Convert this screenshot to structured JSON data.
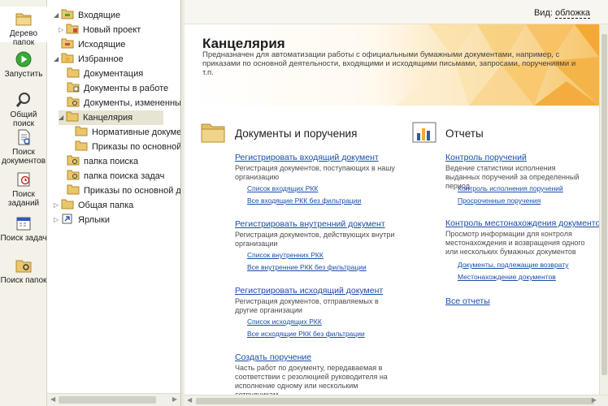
{
  "toolbar": {
    "items": [
      {
        "label": "Дерево папок",
        "icon": "folder-tree-icon"
      },
      {
        "label": "Запустить",
        "icon": "play-icon"
      },
      {
        "label": "Общий поиск",
        "icon": "search-icon"
      },
      {
        "label": "Поиск документов",
        "icon": "document-search-icon"
      },
      {
        "label": "Поиск заданий",
        "icon": "task-search-icon"
      },
      {
        "label": "Поиск задач",
        "icon": "calendar-search-icon"
      },
      {
        "label": "Поиск папок",
        "icon": "folder-search-icon"
      }
    ]
  },
  "tree": {
    "items": [
      {
        "label": "Входящие"
      },
      {
        "label": "Новый проект"
      },
      {
        "label": "Исходящие"
      },
      {
        "label": "Избранное"
      },
      {
        "label": "Документация"
      },
      {
        "label": "Документы в работе"
      },
      {
        "label": "Документы, измененные в т"
      },
      {
        "label": "Канцелярия"
      },
      {
        "label": "Нормативные документы"
      },
      {
        "label": "Приказы по основной дея"
      },
      {
        "label": "папка поиска"
      },
      {
        "label": "папка поиска задач"
      },
      {
        "label": "Приказы по основной деяте"
      },
      {
        "label": "Общая папка"
      },
      {
        "label": "Ярлыки"
      }
    ]
  },
  "header": {
    "view_label": "Вид:",
    "view_value": "обложка"
  },
  "page": {
    "title": "Канцелярия",
    "description": "Предназначен для автоматизации работы с официальными бумажными документами, например, с приказами по основной деятельности, входящими и исходящими письмами, запросами, поручениями и т.п."
  },
  "left_section": {
    "title": "Документы и поручения",
    "blocks": [
      {
        "link": "Регистрировать входящий документ",
        "desc": "Регистрация документов, поступающих в нашу организацию",
        "sublinks": [
          "Список входящих РКК",
          "Все входящие РКК без фильтрации"
        ]
      },
      {
        "link": "Регистрировать внутренний документ",
        "desc": "Регистрация документов, действующих внутри организации",
        "sublinks": [
          "Список внутренних РКК",
          "Все внутренние РКК без фильтрации"
        ]
      },
      {
        "link": "Регистрировать исходящий документ",
        "desc": "Регистрация документов, отправляемых в другие организации",
        "sublinks": [
          "Список исходящих РКК",
          "Все исходящие РКК без фильтрации"
        ]
      },
      {
        "link": "Создать поручение",
        "desc": "Часть работ по документу, передаваемая в соответствии с резолюцией руководителя на исполнение одному или нескольким сотрудникам"
      }
    ]
  },
  "right_section": {
    "title": "Отчеты",
    "blocks": [
      {
        "link": "Контроль поручений",
        "desc": "Ведение статистики исполнения выданных поручений за определенный период",
        "sublinks": [
          "Контроль исполнения поручений",
          "Просроченные поручения"
        ]
      },
      {
        "link": "Контроль местонахождения документов",
        "desc": "Просмотр информации для контроля местонахождения и возвращения одного или нескольких бумажных документов",
        "sublinks": [
          "Документы, подлежащие возврату",
          "Местонахождение документов"
        ]
      }
    ],
    "all_reports": "Все отчеты"
  },
  "colors": {
    "accent_orange": "#f4a934",
    "folder_yellow": "#e9c76a",
    "link_blue": "#1a4da8"
  }
}
